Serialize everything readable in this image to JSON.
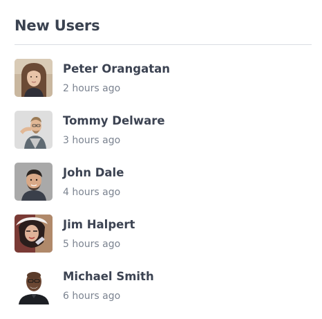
{
  "widget": {
    "title": "New Users"
  },
  "users": [
    {
      "name": "Peter Orangatan",
      "time": "2 hours ago"
    },
    {
      "name": "Tommy Delware",
      "time": "3 hours ago"
    },
    {
      "name": "John Dale",
      "time": "4 hours ago"
    },
    {
      "name": "Jim Halpert",
      "time": "5 hours ago"
    },
    {
      "name": "Michael Smith",
      "time": "6 hours ago"
    }
  ]
}
